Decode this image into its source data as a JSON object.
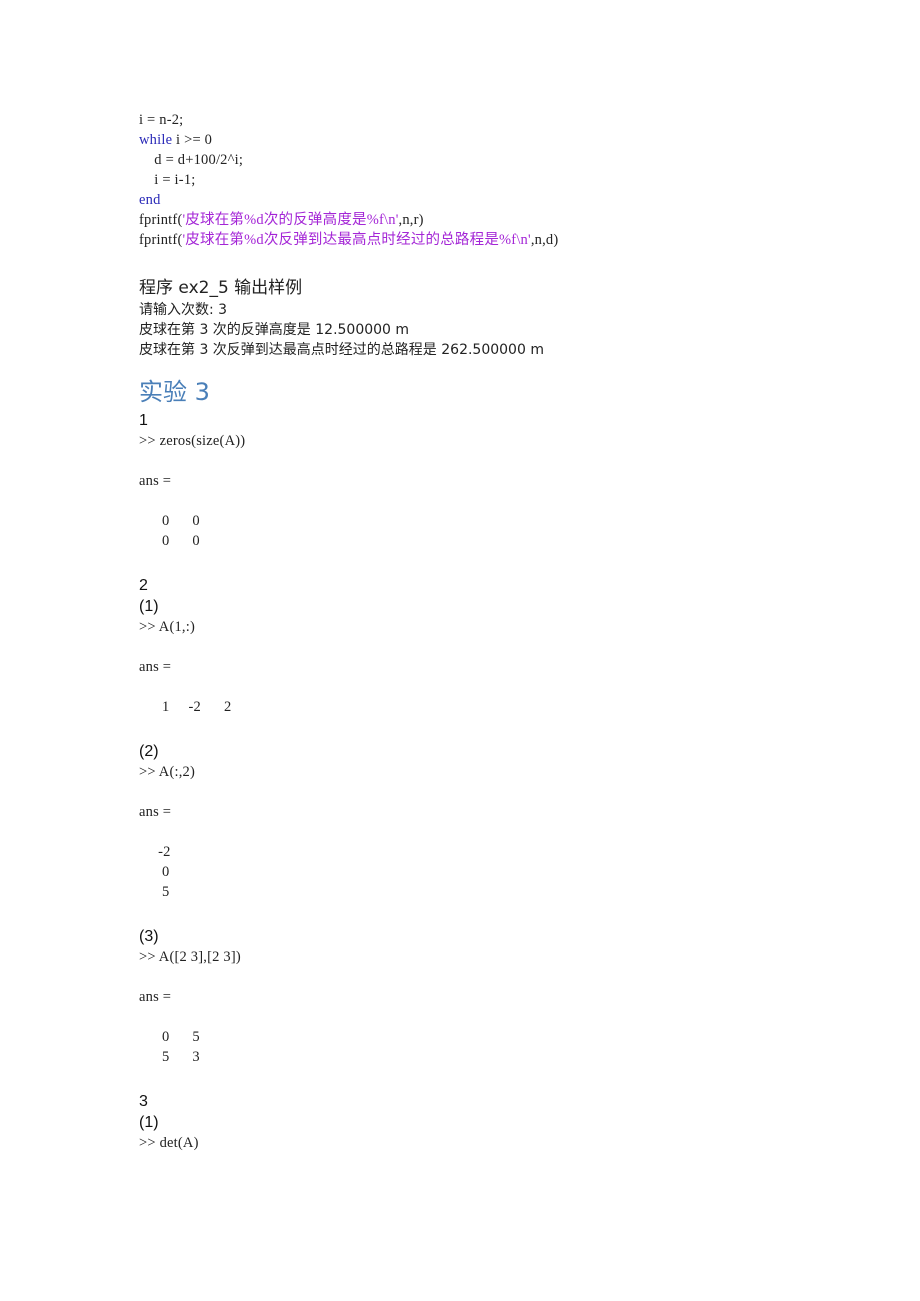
{
  "code_block": {
    "lines": [
      {
        "plain": "i = n-2;"
      },
      {
        "keyword": "while",
        "rest": " i >= 0"
      },
      {
        "plain": "    d = d+100/2^i;"
      },
      {
        "plain": "    i = i-1;"
      },
      {
        "keyword": "end"
      },
      {
        "prefix": "fprintf(",
        "string": "'皮球在第%d次的反弹高度是%f\\n'",
        "suffix": ",n,r)"
      },
      {
        "prefix": "fprintf(",
        "string": "'皮球在第%d次反弹到达最高点时经过的总路程是%f\\n'",
        "suffix": ",n,d)"
      }
    ]
  },
  "sample_output": {
    "title": "程序 ex2_5 输出样例",
    "lines": [
      "请输入次数: 3",
      "皮球在第 3 次的反弹高度是 12.500000 m",
      "皮球在第 3 次反弹到达最高点时经过的总路程是 262.500000 m"
    ]
  },
  "experiment3": {
    "heading": "实验 3",
    "q1": {
      "number": "1",
      "command": ">> zeros(size(A))",
      "ans": "ans =",
      "rows": [
        "      0      0",
        "      0      0"
      ]
    },
    "q2": {
      "number": "2",
      "parts": [
        {
          "label": "(1)",
          "command": ">> A(1,:)",
          "ans": "ans =",
          "rows": [
            "      1     -2      2"
          ]
        },
        {
          "label": "(2)",
          "command": ">> A(:,2)",
          "ans": "ans =",
          "rows": [
            "     -2",
            "      0",
            "      5"
          ]
        },
        {
          "label": "(3)",
          "command": ">> A([2 3],[2 3])",
          "ans": "ans =",
          "rows": [
            "      0      5",
            "      5      3"
          ]
        }
      ]
    },
    "q3": {
      "number": "3",
      "parts": [
        {
          "label": "(1)",
          "command": ">> det(A)"
        }
      ]
    }
  }
}
